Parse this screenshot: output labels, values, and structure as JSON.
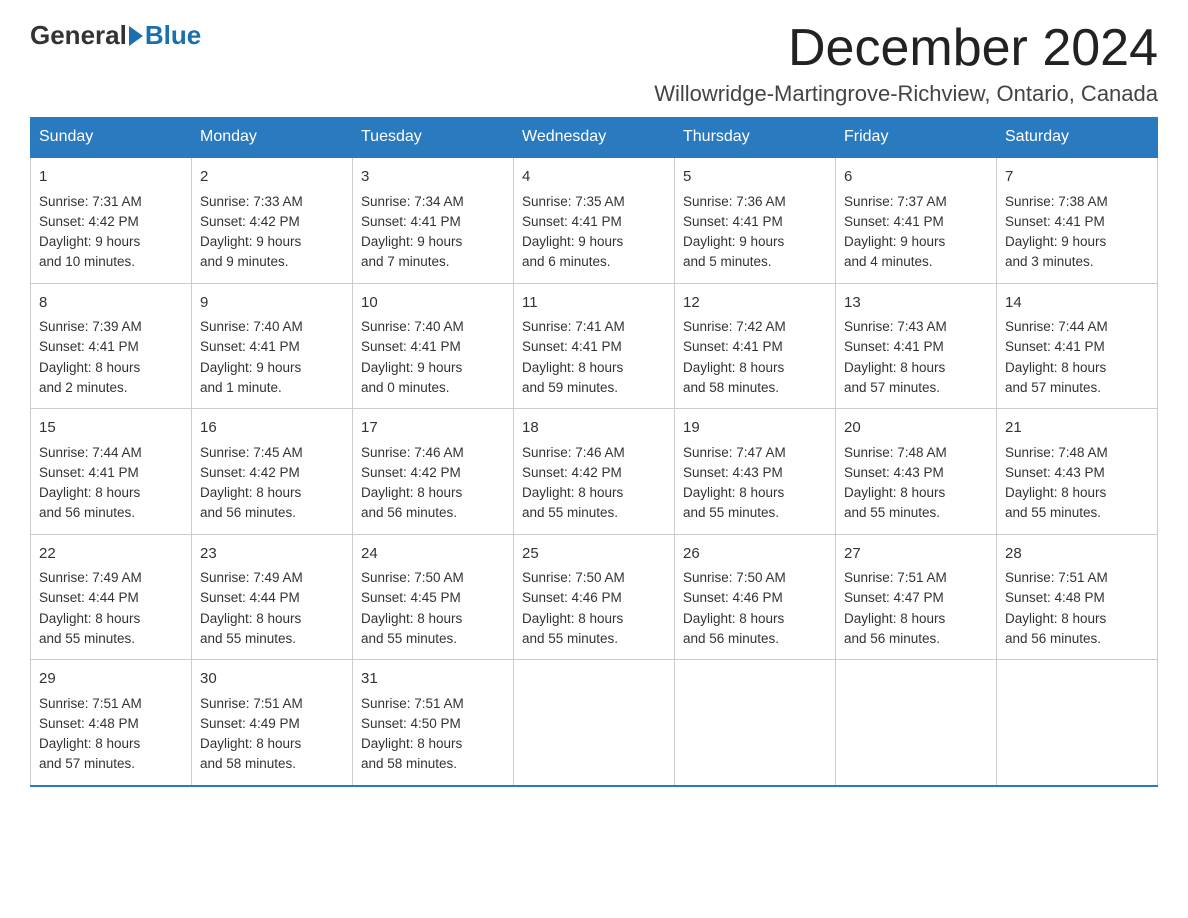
{
  "header": {
    "logo_general": "General",
    "logo_blue": "Blue",
    "month_title": "December 2024",
    "location": "Willowridge-Martingrove-Richview, Ontario, Canada"
  },
  "days_of_week": [
    "Sunday",
    "Monday",
    "Tuesday",
    "Wednesday",
    "Thursday",
    "Friday",
    "Saturday"
  ],
  "weeks": [
    [
      {
        "day": "1",
        "sunrise": "7:31 AM",
        "sunset": "4:42 PM",
        "daylight": "9 hours and 10 minutes."
      },
      {
        "day": "2",
        "sunrise": "7:33 AM",
        "sunset": "4:42 PM",
        "daylight": "9 hours and 9 minutes."
      },
      {
        "day": "3",
        "sunrise": "7:34 AM",
        "sunset": "4:41 PM",
        "daylight": "9 hours and 7 minutes."
      },
      {
        "day": "4",
        "sunrise": "7:35 AM",
        "sunset": "4:41 PM",
        "daylight": "9 hours and 6 minutes."
      },
      {
        "day": "5",
        "sunrise": "7:36 AM",
        "sunset": "4:41 PM",
        "daylight": "9 hours and 5 minutes."
      },
      {
        "day": "6",
        "sunrise": "7:37 AM",
        "sunset": "4:41 PM",
        "daylight": "9 hours and 4 minutes."
      },
      {
        "day": "7",
        "sunrise": "7:38 AM",
        "sunset": "4:41 PM",
        "daylight": "9 hours and 3 minutes."
      }
    ],
    [
      {
        "day": "8",
        "sunrise": "7:39 AM",
        "sunset": "4:41 PM",
        "daylight": "8 hours and 2 minutes."
      },
      {
        "day": "9",
        "sunrise": "7:40 AM",
        "sunset": "4:41 PM",
        "daylight": "9 hours and 1 minute."
      },
      {
        "day": "10",
        "sunrise": "7:40 AM",
        "sunset": "4:41 PM",
        "daylight": "9 hours and 0 minutes."
      },
      {
        "day": "11",
        "sunrise": "7:41 AM",
        "sunset": "4:41 PM",
        "daylight": "8 hours and 59 minutes."
      },
      {
        "day": "12",
        "sunrise": "7:42 AM",
        "sunset": "4:41 PM",
        "daylight": "8 hours and 58 minutes."
      },
      {
        "day": "13",
        "sunrise": "7:43 AM",
        "sunset": "4:41 PM",
        "daylight": "8 hours and 57 minutes."
      },
      {
        "day": "14",
        "sunrise": "7:44 AM",
        "sunset": "4:41 PM",
        "daylight": "8 hours and 57 minutes."
      }
    ],
    [
      {
        "day": "15",
        "sunrise": "7:44 AM",
        "sunset": "4:41 PM",
        "daylight": "8 hours and 56 minutes."
      },
      {
        "day": "16",
        "sunrise": "7:45 AM",
        "sunset": "4:42 PM",
        "daylight": "8 hours and 56 minutes."
      },
      {
        "day": "17",
        "sunrise": "7:46 AM",
        "sunset": "4:42 PM",
        "daylight": "8 hours and 56 minutes."
      },
      {
        "day": "18",
        "sunrise": "7:46 AM",
        "sunset": "4:42 PM",
        "daylight": "8 hours and 55 minutes."
      },
      {
        "day": "19",
        "sunrise": "7:47 AM",
        "sunset": "4:43 PM",
        "daylight": "8 hours and 55 minutes."
      },
      {
        "day": "20",
        "sunrise": "7:48 AM",
        "sunset": "4:43 PM",
        "daylight": "8 hours and 55 minutes."
      },
      {
        "day": "21",
        "sunrise": "7:48 AM",
        "sunset": "4:43 PM",
        "daylight": "8 hours and 55 minutes."
      }
    ],
    [
      {
        "day": "22",
        "sunrise": "7:49 AM",
        "sunset": "4:44 PM",
        "daylight": "8 hours and 55 minutes."
      },
      {
        "day": "23",
        "sunrise": "7:49 AM",
        "sunset": "4:44 PM",
        "daylight": "8 hours and 55 minutes."
      },
      {
        "day": "24",
        "sunrise": "7:50 AM",
        "sunset": "4:45 PM",
        "daylight": "8 hours and 55 minutes."
      },
      {
        "day": "25",
        "sunrise": "7:50 AM",
        "sunset": "4:46 PM",
        "daylight": "8 hours and 55 minutes."
      },
      {
        "day": "26",
        "sunrise": "7:50 AM",
        "sunset": "4:46 PM",
        "daylight": "8 hours and 56 minutes."
      },
      {
        "day": "27",
        "sunrise": "7:51 AM",
        "sunset": "4:47 PM",
        "daylight": "8 hours and 56 minutes."
      },
      {
        "day": "28",
        "sunrise": "7:51 AM",
        "sunset": "4:48 PM",
        "daylight": "8 hours and 56 minutes."
      }
    ],
    [
      {
        "day": "29",
        "sunrise": "7:51 AM",
        "sunset": "4:48 PM",
        "daylight": "8 hours and 57 minutes."
      },
      {
        "day": "30",
        "sunrise": "7:51 AM",
        "sunset": "4:49 PM",
        "daylight": "8 hours and 58 minutes."
      },
      {
        "day": "31",
        "sunrise": "7:51 AM",
        "sunset": "4:50 PM",
        "daylight": "8 hours and 58 minutes."
      },
      null,
      null,
      null,
      null
    ]
  ]
}
